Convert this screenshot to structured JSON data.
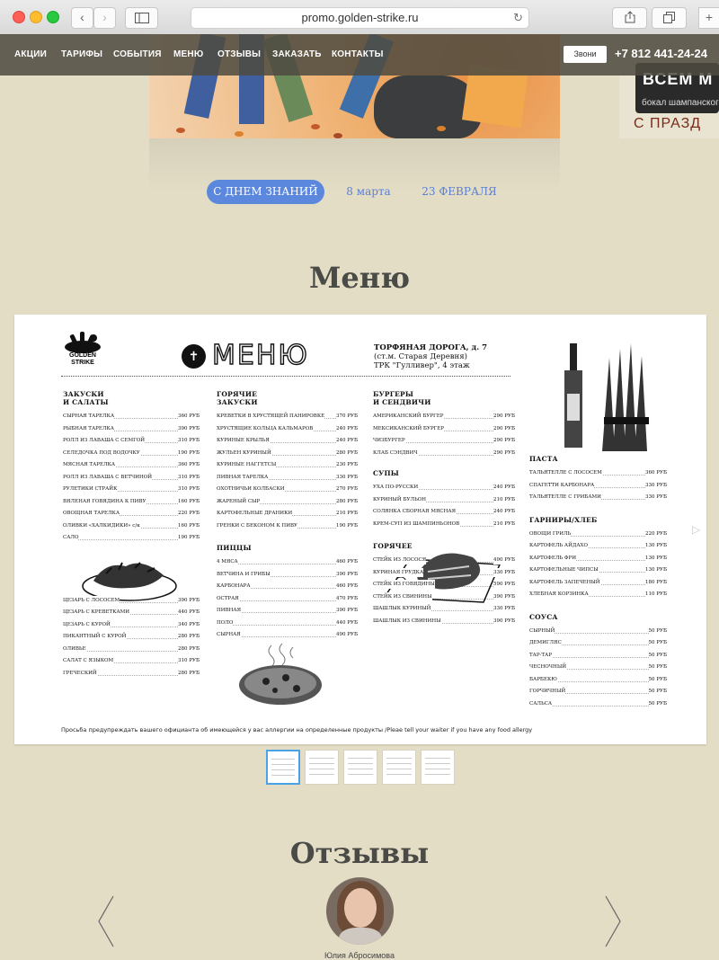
{
  "browser": {
    "url": "promo.golden-strike.ru",
    "back_icon": "chevron-left-icon",
    "forward_icon": "chevron-right-icon"
  },
  "nav": {
    "items": [
      "АКЦИИ",
      "ТАРИФЫ",
      "СОБЫТИЯ",
      "МЕНЮ",
      "ОТЗЫВЫ",
      "ЗАКАЗАТЬ",
      "КОНТАКТЫ"
    ],
    "call_label": "Звони",
    "phone": "+7 812 441-24-24"
  },
  "promo": {
    "title": "ВСЕМ М",
    "subtitle": "бокал шампанского",
    "bottom": "С ПРАЗД"
  },
  "event_tabs": {
    "items": [
      "С ДНЕМ ЗНАНИЙ",
      "8 марта",
      "23 ФЕВРАЛЯ"
    ],
    "active_index": 0
  },
  "menu_section": {
    "title": "Меню",
    "card": {
      "logo_line1": "GOLDEN",
      "logo_line2": "STRIKE",
      "heading": "МЕНЮ",
      "address": [
        "ТОРФЯНАЯ ДОРОГА, д. 7",
        "(ст.м. Старая Деревня)",
        "ТРК \"Гулливер\", 4 этаж"
      ],
      "footnote": "Просьба предупреждать вашего официанта об имеющейся у вас аллергии на определенные продукты /Pleae tell your waiter if you have any food allergy",
      "columns": [
        [
          {
            "title": "ЗАКУСКИ\nИ САЛАТЫ",
            "items": [
              [
                "СЫРНАЯ ТАРЕЛКА",
                "360 РУБ"
              ],
              [
                "РЫБНАЯ ТАРЕЛКА",
                "390 РУБ"
              ],
              [
                "РОЛЛ ИЗ ЛАВАША С СЕМГОЙ",
                "310 РУБ"
              ],
              [
                "СЕЛЕДОЧКА ПОД ВОДОЧКУ",
                "190 РУБ"
              ],
              [
                "МЯСНАЯ ТАРЕЛКА",
                "360 РУБ"
              ],
              [
                "РОЛЛ ИЗ ЛАВАША С ВЕТЧИНОЙ",
                "310 РУБ"
              ],
              [
                "РУЛЕТИКИ СТРАЙК",
                "310 РУБ"
              ],
              [
                "ВЯЛЕНАЯ ГОВЯДИНА К ПИВУ",
                "160 РУБ"
              ],
              [
                "ОВОЩНАЯ ТАРЕЛКА",
                "220 РУБ"
              ],
              [
                "ОЛИВКИ «ХАЛКИДИКИ» с/к",
                "160 РУБ"
              ],
              [
                "САЛО",
                "190 РУБ"
              ]
            ]
          },
          {
            "title": "",
            "items": [
              [
                "ЦЕЗАРЬ С ЛОСОСЕМ",
                "390 РУБ"
              ],
              [
                "ЦЕЗАРЬ С КРЕВЕТКАМИ",
                "440 РУБ"
              ],
              [
                "ЦЕЗАРЬ С КУРОЙ",
                "340 РУБ"
              ],
              [
                "ПИКАНТНЫЙ С КУРОЙ",
                "280 РУБ"
              ],
              [
                "ОЛИВЬЕ",
                "280 РУБ"
              ],
              [
                "САЛАТ С ЯЗЫКОМ",
                "310 РУБ"
              ],
              [
                "ГРЕЧЕСКИЙ",
                "280 РУБ"
              ]
            ]
          }
        ],
        [
          {
            "title": "ГОРЯЧИЕ\nЗАКУСКИ",
            "items": [
              [
                "КРЕВЕТКИ В ХРУСТЯЩЕЙ ПАНИРОВКЕ",
                "370 РУБ"
              ],
              [
                "ХРУСТЯЩИЕ КОЛЬЦА КАЛЬМАРОВ",
                "240 РУБ"
              ],
              [
                "КУРИНЫЕ КРЫЛЬЯ",
                "240 РУБ"
              ],
              [
                "ЖУЛЬЕН КУРИНЫЙ",
                "280 РУБ"
              ],
              [
                "КУРИНЫЕ НАГГЕТСЫ",
                "230 РУБ"
              ],
              [
                "ПИВНАЯ ТАРЕЛКА",
                "330 РУБ"
              ],
              [
                "ОХОТНИЧЬИ КОЛБАСКИ",
                "270 РУБ"
              ],
              [
                "ЖАРЕНЫЙ СЫР",
                "280 РУБ"
              ],
              [
                "КАРТОФЕЛЬНЫЕ ДРАНИКИ",
                "210 РУБ"
              ],
              [
                "ГРЕНКИ С БЕКОНОМ К ПИВУ",
                "190 РУБ"
              ]
            ]
          },
          {
            "title": "ПИЦЦЫ",
            "items": [
              [
                "4 МЯСА",
                "460 РУБ"
              ],
              [
                "ВЕТЧИНА И ГРИБЫ",
                "390 РУБ"
              ],
              [
                "КАРБОНАРА",
                "460 РУБ"
              ],
              [
                "ОСТРАЯ",
                "470 РУБ"
              ],
              [
                "ПИВНАЯ",
                "390 РУБ"
              ],
              [
                "ПОЛО",
                "440 РУБ"
              ],
              [
                "СЫРНАЯ",
                "490 РУБ"
              ]
            ]
          }
        ],
        [
          {
            "title": "БУРГЕРЫ\nИ СЕНДВИЧИ",
            "items": [
              [
                "АМЕРИКАНСКИЙ БУРГЕР",
                "290 РУБ"
              ],
              [
                "МЕКСИКАНСКИЙ БУРГЕР",
                "290 РУБ"
              ],
              [
                "ЧИЗБУРГЕР",
                "290 РУБ"
              ],
              [
                "КЛАБ СЭНДВИЧ",
                "290 РУБ"
              ]
            ]
          },
          {
            "title": "СУПЫ",
            "items": [
              [
                "УХА ПО-РУССКИ",
                "240 РУБ"
              ],
              [
                "КУРИНЫЙ БУЛЬОН",
                "210 РУБ"
              ],
              [
                "СОЛЯНКА СБОРНАЯ МЯСНАЯ",
                "240 РУБ"
              ],
              [
                "КРЕМ-СУП ИЗ ШАМПИНЬОНОВ",
                "210 РУБ"
              ]
            ]
          },
          {
            "title": "ГОРЯЧЕЕ",
            "items": [
              [
                "СТЕЙК ИЗ ЛОСОСЯ",
                "490 РУБ"
              ],
              [
                "КУРИНАЯ ГРУДКА",
                "330 РУБ"
              ],
              [
                "СТЕЙК ИЗ ГОВЯДИНЫ",
                "590 РУБ"
              ],
              [
                "СТЕЙК ИЗ СВИНИНЫ",
                "390 РУБ"
              ],
              [
                "ШАШЛЫК КУРИНЫЙ",
                "330 РУБ"
              ],
              [
                "ШАШЛЫК ИЗ СВИНИНЫ",
                "390 РУБ"
              ]
            ]
          }
        ],
        [
          {
            "title": "ПАСТА",
            "items": [
              [
                "ТАЛЬЯТЕЛЛЕ С ЛОСОСЕМ",
                "360 РУБ"
              ],
              [
                "СПАГЕТТИ КАРБОНАРА",
                "330 РУБ"
              ],
              [
                "ТАЛЬЯТЕЛЛЕ С ГРИБАМИ",
                "330 РУБ"
              ]
            ]
          },
          {
            "title": "ГАРНИРЫ/ХЛЕБ",
            "items": [
              [
                "ОВОЩИ ГРИЛЬ",
                "220 РУБ"
              ],
              [
                "КАРТОФЕЛЬ АЙДАХО",
                "130 РУБ"
              ],
              [
                "КАРТОФЕЛЬ ФРИ",
                "130 РУБ"
              ],
              [
                "КАРТОФЕЛЬНЫЕ ЧИПСЫ",
                "130 РУБ"
              ],
              [
                "КАРТОФЕЛЬ ЗАПЕЧЕНЫЙ",
                "180 РУБ"
              ],
              [
                "ХЛЕБНАЯ КОРЗИНКА",
                "110 РУБ"
              ]
            ]
          },
          {
            "title": "СОУСА",
            "items": [
              [
                "СЫРНЫЙ",
                "50 РУБ"
              ],
              [
                "ДЕМИГЛЯС",
                "50 РУБ"
              ],
              [
                "ТАР-ТАР",
                "50 РУБ"
              ],
              [
                "ЧЕСНОЧНЫЙ",
                "50 РУБ"
              ],
              [
                "БАРБЕКЮ",
                "50 РУБ"
              ],
              [
                "ГОРЧИЧНЫЙ",
                "50 РУБ"
              ],
              [
                "САЛЬСА",
                "50 РУБ"
              ]
            ]
          }
        ]
      ]
    },
    "thumbnails_count": 5,
    "active_thumbnail": 0
  },
  "reviews": {
    "title": "Отзывы",
    "reviewer_name": "Юлия Абросимова"
  },
  "colors": {
    "page_bg": "#e3ddc6",
    "nav_bg": "#4e4a40",
    "accent": "#5b87dd"
  }
}
